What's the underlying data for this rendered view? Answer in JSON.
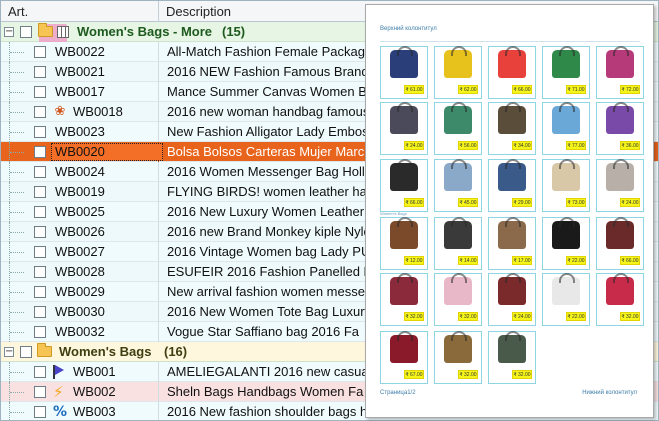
{
  "columns": {
    "art": "Art.",
    "description": "Description"
  },
  "groups": [
    {
      "title": "Women's Bags - More",
      "count": "(15)",
      "rows": [
        {
          "code": "WB0022",
          "desc": "All-Match Fashion Female Package"
        },
        {
          "code": "WB0021",
          "desc": "2016 NEW Fashion Famous Brand"
        },
        {
          "code": "WB0017",
          "desc": "Mance Summer Canvas Women B"
        },
        {
          "code": "WB0018",
          "desc": "2016 new woman handbag famous",
          "icon": "ribbon-medal-icon"
        },
        {
          "code": "WB0023",
          "desc": "New Fashion Alligator Lady Embos"
        },
        {
          "code": "WB0020",
          "desc": "Bolsa Bolsos Carteras Mujer Marc",
          "state": "selected"
        },
        {
          "code": "WB0024",
          "desc": "2016 Women Messenger Bag Holl"
        },
        {
          "code": "WB0019",
          "desc": "FLYING BIRDS! women leather har"
        },
        {
          "code": "WB0025",
          "desc": "2016 New Luxury Women Leather"
        },
        {
          "code": "WB0026",
          "desc": "2016 new Brand Monkey kiple Nylo"
        },
        {
          "code": "WB0027",
          "desc": "2016 Vintage Women bag Lady PU"
        },
        {
          "code": "WB0028",
          "desc": "ESUFEIR 2016 Fashion Panelled L"
        },
        {
          "code": "WB0029",
          "desc": "New arrival fashion women messer"
        },
        {
          "code": "WB0030",
          "desc": "2016 New Women Tote Bag Luxury"
        },
        {
          "code": "WB0032",
          "desc": "Vogue Star Saffiano bag 2016 Fa"
        }
      ]
    },
    {
      "title": "Women's Bags",
      "count": "(16)",
      "rows": [
        {
          "code": "WB001",
          "desc": "AMELIEGALANTI 2016 new casua",
          "icon": "flag-icon"
        },
        {
          "code": "WB002",
          "desc": "Sheln Bags Handbags Women Fa",
          "icon": "lightning-icon",
          "state": "pink"
        },
        {
          "code": "WB003",
          "desc": "2016 New fashion shoulder bags h",
          "icon": "percent-icon"
        }
      ]
    }
  ],
  "preview": {
    "header": "Верхний колонтитул",
    "group1": "Women's Bags - More",
    "group2": "Women's Bags",
    "footer_left": "Страница1/2",
    "footer_right": "Нижний колонтитул",
    "cards": [
      {
        "color": "#2a3f7a",
        "price": "₹ 61.00"
      },
      {
        "color": "#e8c21c",
        "price": "₹ 62.00"
      },
      {
        "color": "#e8403a",
        "price": "₹ 66.00"
      },
      {
        "color": "#2f8a4a",
        "price": "₹ 71.00"
      },
      {
        "color": "#b63a7a",
        "price": "₹ 72.00"
      },
      {
        "color": "#4a4a5a",
        "price": "₹ 24.00"
      },
      {
        "color": "#3d8a6a",
        "price": "₹ 56.00"
      },
      {
        "color": "#5a4d3a",
        "price": "₹ 34.00"
      },
      {
        "color": "#6aa8d8",
        "price": "₹ 77.00"
      },
      {
        "color": "#7a4aa8",
        "price": "₹ 36.00"
      },
      {
        "color": "#2a2a2a",
        "price": "₹ 66.00"
      },
      {
        "color": "#8aa8c8",
        "price": "₹ 45.00"
      },
      {
        "color": "#3a5a8a",
        "price": "₹ 29.00"
      },
      {
        "color": "#d8c8a8",
        "price": "₹ 73.00"
      },
      {
        "color": "#b8b0a8",
        "price": "₹ 24.00"
      },
      {
        "color": "#7a4a2a",
        "price": "₹ 12.00"
      },
      {
        "color": "#3a3a3a",
        "price": "₹ 14.00"
      },
      {
        "color": "#8a6a4a",
        "price": "₹ 17.00"
      },
      {
        "color": "#1a1a1a",
        "price": "₹ 22.00"
      },
      {
        "color": "#6a2a2a",
        "price": "₹ 66.00"
      },
      {
        "color": "#8a2a3a",
        "price": "₹ 32.00"
      },
      {
        "color": "#e8b8c8",
        "price": "₹ 32.00"
      },
      {
        "color": "#7a2a2a",
        "price": "₹ 24.00"
      },
      {
        "color": "#e8e8e8",
        "price": "₹ 22.00"
      },
      {
        "color": "#c82a4a",
        "price": "₹ 32.00"
      },
      {
        "color": "#8a1a2a",
        "price": "₹ 67.00"
      },
      {
        "color": "#8a6a3a",
        "price": "₹ 32.00"
      },
      {
        "color": "#4a5a4a",
        "price": "₹ 32.00"
      }
    ]
  }
}
